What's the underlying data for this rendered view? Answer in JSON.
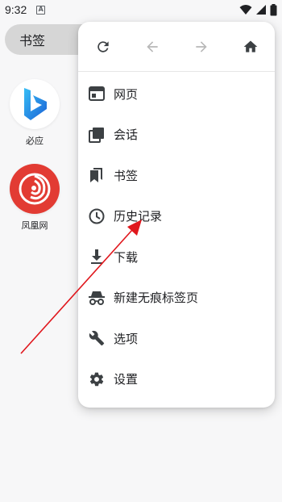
{
  "status_bar": {
    "time": "9:32",
    "notification_icon": "a-square-icon",
    "icons": [
      "wifi-icon",
      "signal-icon",
      "battery-icon"
    ]
  },
  "background": {
    "bookmark_chip": "书签",
    "speed_dial": [
      {
        "label": "必应",
        "icon": "bing-logo"
      },
      {
        "label": "凤凰网",
        "icon": "ifeng-logo"
      }
    ]
  },
  "menu": {
    "toolbar": [
      "refresh-icon",
      "back-arrow-icon",
      "forward-arrow-icon",
      "home-icon"
    ],
    "items": [
      {
        "label": "网页",
        "icon": "tab-icon"
      },
      {
        "label": "会话",
        "icon": "session-icon"
      },
      {
        "label": "书签",
        "icon": "bookmark-icon"
      },
      {
        "label": "历史记录",
        "icon": "history-clock-icon"
      },
      {
        "label": "下载",
        "icon": "download-icon"
      },
      {
        "label": "新建无痕标签页",
        "icon": "incognito-icon"
      },
      {
        "label": "选项",
        "icon": "wrench-icon"
      },
      {
        "label": "设置",
        "icon": "gear-icon"
      }
    ]
  },
  "colors": {
    "annotation_arrow": "#e0161c",
    "bing_blue": "#1b8ddc",
    "ifeng_red": "#e23b33"
  }
}
